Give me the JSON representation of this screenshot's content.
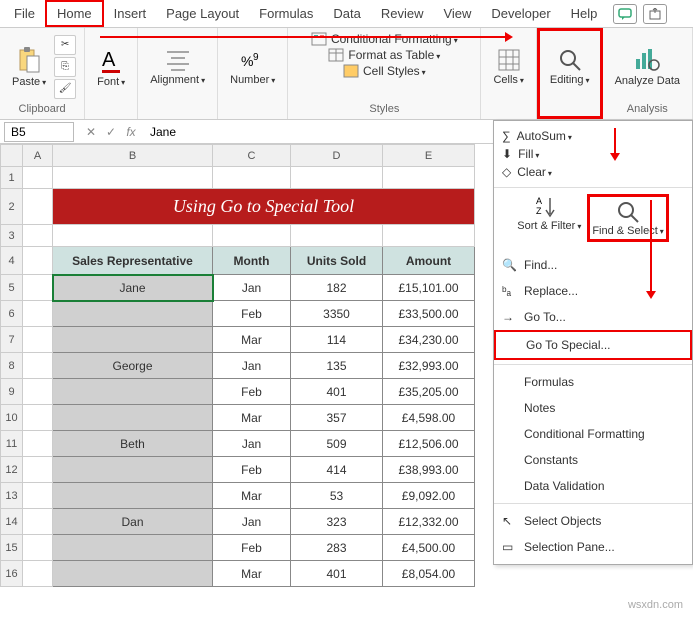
{
  "tabs": [
    "File",
    "Home",
    "Insert",
    "Page Layout",
    "Formulas",
    "Data",
    "Review",
    "View",
    "Developer",
    "Help"
  ],
  "ribbon": {
    "clipboard": "Clipboard",
    "paste": "Paste",
    "font": "Font",
    "alignment": "Alignment",
    "number": "Number",
    "styles": "Styles",
    "cond_format": "Conditional Formatting",
    "format_table": "Format as Table",
    "cell_styles": "Cell Styles",
    "cells": "Cells",
    "editing": "Editing",
    "analyze": "Analyze Data",
    "analysis": "Analysis"
  },
  "editing_panel": {
    "autosum": "AutoSum",
    "fill": "Fill",
    "clear": "Clear",
    "sort": "Sort & Filter",
    "find": "Find & Select",
    "menu": {
      "find_item": "Find...",
      "replace": "Replace...",
      "goto": "Go To...",
      "special": "Go To Special...",
      "formulas": "Formulas",
      "notes": "Notes",
      "cond": "Conditional Formatting",
      "constants": "Constants",
      "datav": "Data Validation",
      "selobj": "Select Objects",
      "selpane": "Selection Pane..."
    }
  },
  "namebox": "B5",
  "formula": "Jane",
  "columns": [
    "A",
    "B",
    "C",
    "D",
    "E"
  ],
  "banner": "Using Go to Special Tool",
  "headers": {
    "b": "Sales Representative",
    "c": "Month",
    "d": "Units Sold",
    "e": "Amount"
  },
  "rows": [
    {
      "r": "5",
      "b": "Jane",
      "c": "Jan",
      "d": "182",
      "e": "£15,101.00"
    },
    {
      "r": "6",
      "b": "",
      "c": "Feb",
      "d": "3350",
      "e": "£33,500.00"
    },
    {
      "r": "7",
      "b": "",
      "c": "Mar",
      "d": "114",
      "e": "£34,230.00"
    },
    {
      "r": "8",
      "b": "George",
      "c": "Jan",
      "d": "135",
      "e": "£32,993.00"
    },
    {
      "r": "9",
      "b": "",
      "c": "Feb",
      "d": "401",
      "e": "£35,205.00"
    },
    {
      "r": "10",
      "b": "",
      "c": "Mar",
      "d": "357",
      "e": "£4,598.00"
    },
    {
      "r": "11",
      "b": "Beth",
      "c": "Jan",
      "d": "509",
      "e": "£12,506.00"
    },
    {
      "r": "12",
      "b": "",
      "c": "Feb",
      "d": "414",
      "e": "£38,993.00"
    },
    {
      "r": "13",
      "b": "",
      "c": "Mar",
      "d": "53",
      "e": "£9,092.00"
    },
    {
      "r": "14",
      "b": "Dan",
      "c": "Jan",
      "d": "323",
      "e": "£12,332.00"
    },
    {
      "r": "15",
      "b": "",
      "c": "Feb",
      "d": "283",
      "e": "£4,500.00"
    },
    {
      "r": "16",
      "b": "",
      "c": "Mar",
      "d": "401",
      "e": "£8,054.00"
    }
  ],
  "watermark": "wsxdn.com"
}
